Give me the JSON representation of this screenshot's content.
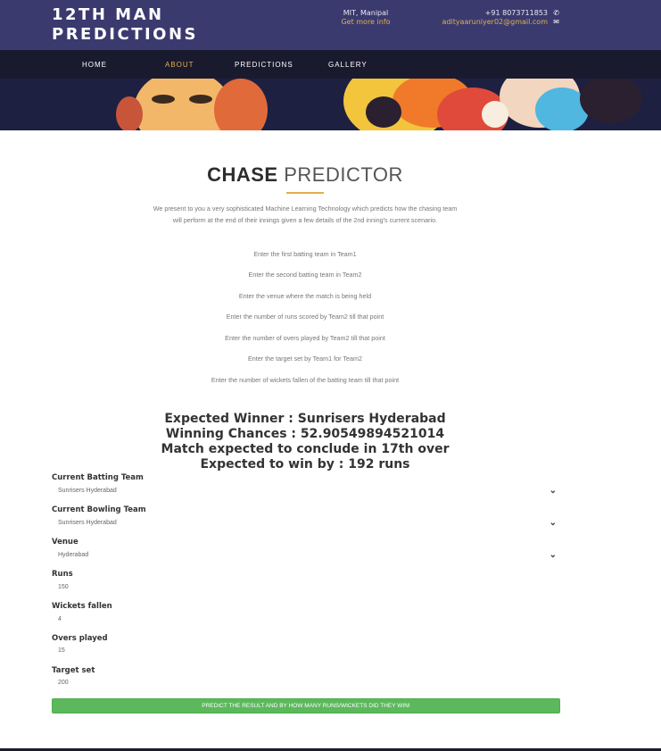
{
  "brand": {
    "line1": "12TH MAN",
    "line2": "PREDICTIONS"
  },
  "location": {
    "place": "MIT, Manipal",
    "more_link": "Get more info"
  },
  "contact": {
    "phone": "+91 8073711853",
    "email": "adityaaruniyer02@gmail.com",
    "phone_icon": "phone-icon",
    "email_icon": "envelope-icon"
  },
  "nav": {
    "items": [
      "HOME",
      "ABOUT",
      "PREDICTIONS",
      "GALLERY"
    ],
    "active": "ABOUT"
  },
  "page": {
    "title_bold": "CHASE",
    "title_light": "PREDICTOR",
    "description": "We present to you a very sophisticated Machine Learning Technology which predicts how the chasing team will perform at the end of their innings given a few details of the 2nd inning's current scenario.",
    "hints": [
      "Enter the first batting team in Team1",
      "Enter the second batting team in Team2",
      "Enter the venue where the match is being held",
      "Enter the number of runs scored by Team2 till that point",
      "Enter the number of overs played by Team2 till that point",
      "Enter the target set by Team1 for Team2",
      "Enter the number of wickets fallen of the batting team till that point"
    ]
  },
  "result": {
    "winner": "Expected Winner : Sunrisers Hyderabad",
    "chances": "Winning Chances : 52.90549894521014",
    "conclude": "Match expected to conclude in 17th over",
    "margin": "Expected to win by : 192 runs"
  },
  "form": {
    "batting_team": {
      "label": "Current Batting Team",
      "value": "Sunrisers Hyderabad"
    },
    "bowling_team": {
      "label": "Current Bowling Team",
      "value": "Sunrisers Hyderabad"
    },
    "venue": {
      "label": "Venue",
      "value": "Hyderabad"
    },
    "runs": {
      "label": "Runs",
      "value": "150"
    },
    "wickets": {
      "label": "Wickets fallen",
      "value": "4"
    },
    "overs": {
      "label": "Overs played",
      "value": "15"
    },
    "target": {
      "label": "Target set",
      "value": "200"
    },
    "submit_label": "PREDICT THE RESULT AND BY HOW MANY RUNS/WICKETS DID THEY WIN!"
  },
  "colors": {
    "accent": "#e0b04a",
    "header": "#3b3a6f",
    "submit": "#5cb85c"
  }
}
